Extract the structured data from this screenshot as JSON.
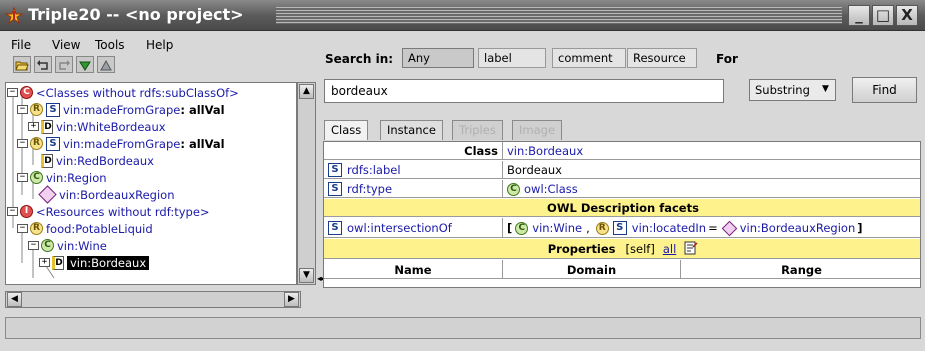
{
  "window": {
    "title": "Triple20 -- <no project>",
    "minimize": "_",
    "maximize": "□",
    "close": "X"
  },
  "menu": {
    "file": "File",
    "view": "View",
    "tools": "Tools",
    "help": "Help"
  },
  "toolbar": {
    "open_icon": "folder-open-icon",
    "undo_icon": "undo-icon",
    "redo_icon": "redo-icon",
    "down_icon": "down-arrow-icon",
    "up_icon": "up-arrow-icon"
  },
  "tree": {
    "nodes": [
      {
        "label": "<Classes without rdfs:subClassOf>",
        "icon": "red-c",
        "glyph": "C"
      },
      {
        "label": "vin:madeFromGrape",
        "suffix": ": allVal",
        "icon": "restriction",
        "glyph": "R"
      },
      {
        "label": "vin:WhiteBordeaux",
        "icon": "document",
        "glyph": "D"
      },
      {
        "label": "vin:madeFromGrape",
        "suffix": ": allVal",
        "icon": "restriction",
        "glyph": "R"
      },
      {
        "label": "vin:RedBordeaux",
        "icon": "document",
        "glyph": "D"
      },
      {
        "label": "vin:Region",
        "icon": "class",
        "glyph": "C"
      },
      {
        "label": "vin:BordeauxRegion",
        "icon": "individual",
        "glyph": "I"
      },
      {
        "label": "<Resources without rdf:type>",
        "icon": "red-i",
        "glyph": "I"
      },
      {
        "label": "food:PotableLiquid",
        "icon": "restriction",
        "glyph": "R"
      },
      {
        "label": "vin:Wine",
        "icon": "class",
        "glyph": "C"
      },
      {
        "label": "vin:Bordeaux",
        "icon": "document",
        "glyph": "D",
        "selected": true
      }
    ],
    "s_badge": "S",
    "expand": "−",
    "collapse": "+"
  },
  "search": {
    "label": "Search in:",
    "options": [
      "Any",
      "label",
      "comment",
      "Resource"
    ],
    "active_option": "Any",
    "for_label": "For",
    "query": "bordeaux",
    "match_mode": "Substring",
    "find_label": "Find"
  },
  "tabs": [
    {
      "label": "Class",
      "state": "active"
    },
    {
      "label": "Instance",
      "state": "normal"
    },
    {
      "label": "Triples",
      "state": "disabled"
    },
    {
      "label": "Image",
      "state": "disabled"
    }
  ],
  "grid": {
    "class_header": "Class",
    "class_value": "vin:Bordeaux",
    "rows": [
      {
        "badge": "S",
        "predicate": "rdfs:label",
        "value": "Bordeaux"
      },
      {
        "badge": "S",
        "predicate": "rdf:type",
        "value_icon": "C",
        "value": "owl:Class"
      }
    ],
    "owl_header": "OWL Description facets",
    "owl_row": {
      "badge": "S",
      "predicate": "owl:intersectionOf",
      "open_bracket": "[",
      "class_icon": "C",
      "first": "vin:Wine",
      "comma": ",",
      "restr_icon": "R",
      "restr_badge": "S",
      "property": "vin:locatedIn",
      "equals": "=",
      "individual": "vin:BordeauxRegion",
      "close_bracket": "]"
    },
    "properties_header": "Properties",
    "properties_self": "[self]",
    "properties_all": "all",
    "columns": [
      "Name",
      "Domain",
      "Range"
    ]
  }
}
